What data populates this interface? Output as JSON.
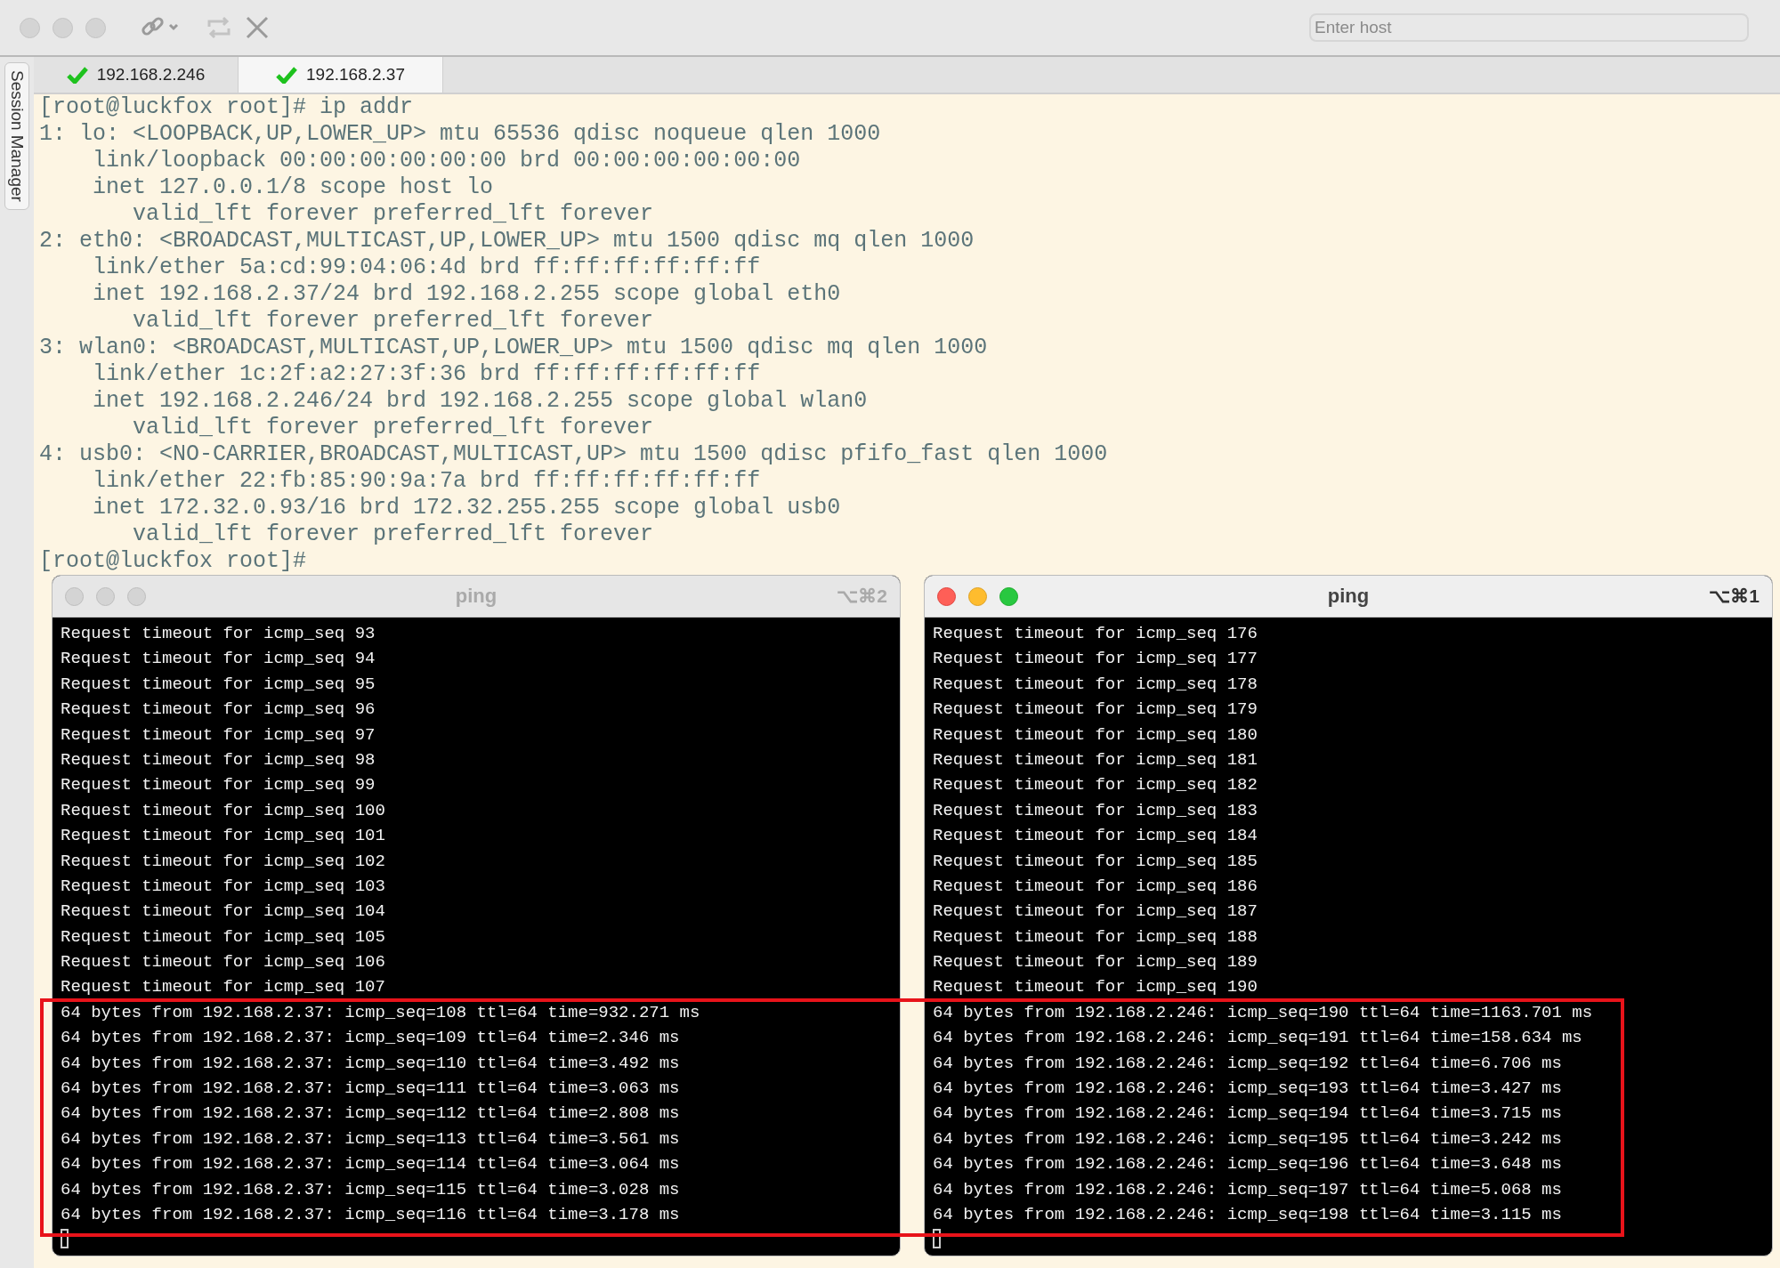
{
  "toolbar": {
    "host_field": {
      "placeholder": "Enter host"
    }
  },
  "sidebar": {
    "tab": "Session Manager"
  },
  "tabs": [
    {
      "label": "192.168.2.246",
      "selected": false
    },
    {
      "label": "192.168.2.37",
      "selected": true
    }
  ],
  "terminal": {
    "lines": [
      "[root@luckfox root]# ip addr",
      "1: lo: <LOOPBACK,UP,LOWER_UP> mtu 65536 qdisc noqueue qlen 1000",
      "    link/loopback 00:00:00:00:00:00 brd 00:00:00:00:00:00",
      "    inet 127.0.0.1/8 scope host lo",
      "       valid_lft forever preferred_lft forever",
      "2: eth0: <BROADCAST,MULTICAST,UP,LOWER_UP> mtu 1500 qdisc mq qlen 1000",
      "    link/ether 5a:cd:99:04:06:4d brd ff:ff:ff:ff:ff:ff",
      "    inet 192.168.2.37/24 brd 192.168.2.255 scope global eth0",
      "       valid_lft forever preferred_lft forever",
      "3: wlan0: <BROADCAST,MULTICAST,UP,LOWER_UP> mtu 1500 qdisc mq qlen 1000",
      "    link/ether 1c:2f:a2:27:3f:36 brd ff:ff:ff:ff:ff:ff",
      "    inet 192.168.2.246/24 brd 192.168.2.255 scope global wlan0",
      "       valid_lft forever preferred_lft forever",
      "4: usb0: <NO-CARRIER,BROADCAST,MULTICAST,UP> mtu 1500 qdisc pfifo_fast qlen 1000",
      "    link/ether 22:fb:85:90:9a:7a brd ff:ff:ff:ff:ff:ff",
      "    inet 172.32.0.93/16 brd 172.32.255.255 scope global usb0",
      "       valid_lft forever preferred_lft forever",
      "[root@luckfox root]#"
    ]
  },
  "ping_windows": [
    {
      "title": "ping",
      "shortcut": "⌥⌘2",
      "focused": false,
      "lines": [
        "Request timeout for icmp_seq 93",
        "Request timeout for icmp_seq 94",
        "Request timeout for icmp_seq 95",
        "Request timeout for icmp_seq 96",
        "Request timeout for icmp_seq 97",
        "Request timeout for icmp_seq 98",
        "Request timeout for icmp_seq 99",
        "Request timeout for icmp_seq 100",
        "Request timeout for icmp_seq 101",
        "Request timeout for icmp_seq 102",
        "Request timeout for icmp_seq 103",
        "Request timeout for icmp_seq 104",
        "Request timeout for icmp_seq 105",
        "Request timeout for icmp_seq 106",
        "Request timeout for icmp_seq 107",
        "64 bytes from 192.168.2.37: icmp_seq=108 ttl=64 time=932.271 ms",
        "64 bytes from 192.168.2.37: icmp_seq=109 ttl=64 time=2.346 ms",
        "64 bytes from 192.168.2.37: icmp_seq=110 ttl=64 time=3.492 ms",
        "64 bytes from 192.168.2.37: icmp_seq=111 ttl=64 time=3.063 ms",
        "64 bytes from 192.168.2.37: icmp_seq=112 ttl=64 time=2.808 ms",
        "64 bytes from 192.168.2.37: icmp_seq=113 ttl=64 time=3.561 ms",
        "64 bytes from 192.168.2.37: icmp_seq=114 ttl=64 time=3.064 ms",
        "64 bytes from 192.168.2.37: icmp_seq=115 ttl=64 time=3.028 ms",
        "64 bytes from 192.168.2.37: icmp_seq=116 ttl=64 time=3.178 ms"
      ]
    },
    {
      "title": "ping",
      "shortcut": "⌥⌘1",
      "focused": true,
      "lines": [
        "Request timeout for icmp_seq 176",
        "Request timeout for icmp_seq 177",
        "Request timeout for icmp_seq 178",
        "Request timeout for icmp_seq 179",
        "Request timeout for icmp_seq 180",
        "Request timeout for icmp_seq 181",
        "Request timeout for icmp_seq 182",
        "Request timeout for icmp_seq 183",
        "Request timeout for icmp_seq 184",
        "Request timeout for icmp_seq 185",
        "Request timeout for icmp_seq 186",
        "Request timeout for icmp_seq 187",
        "Request timeout for icmp_seq 188",
        "Request timeout for icmp_seq 189",
        "Request timeout for icmp_seq 190",
        "64 bytes from 192.168.2.246: icmp_seq=190 ttl=64 time=1163.701 ms",
        "64 bytes from 192.168.2.246: icmp_seq=191 ttl=64 time=158.634 ms",
        "64 bytes from 192.168.2.246: icmp_seq=192 ttl=64 time=6.706 ms",
        "64 bytes from 192.168.2.246: icmp_seq=193 ttl=64 time=3.427 ms",
        "64 bytes from 192.168.2.246: icmp_seq=194 ttl=64 time=3.715 ms",
        "64 bytes from 192.168.2.246: icmp_seq=195 ttl=64 time=3.242 ms",
        "64 bytes from 192.168.2.246: icmp_seq=196 ttl=64 time=3.648 ms",
        "64 bytes from 192.168.2.246: icmp_seq=197 ttl=64 time=5.068 ms",
        "64 bytes from 192.168.2.246: icmp_seq=198 ttl=64 time=3.115 ms"
      ]
    }
  ]
}
